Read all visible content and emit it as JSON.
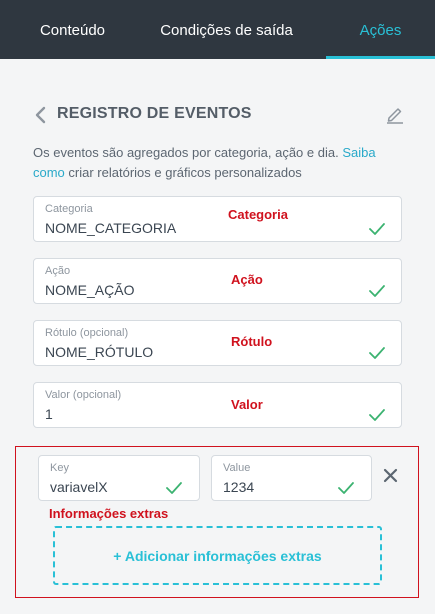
{
  "tabs": [
    {
      "label": "Conteúdo",
      "active": false
    },
    {
      "label": "Condições de saída",
      "active": false
    },
    {
      "label": "Ações",
      "active": true
    }
  ],
  "header": {
    "title": "REGISTRO DE EVENTOS",
    "back_icon": "chevron-left-icon",
    "edit_icon": "pencil-icon"
  },
  "description": {
    "text_before": "Os eventos são agregados por categoria, ação e dia. ",
    "link": "Saiba como",
    "text_after": " criar relatórios e gráficos personalizados"
  },
  "fields": [
    {
      "label": "Categoria",
      "value": "NOME_CATEGORIA",
      "annotation": "Categoria",
      "valid": true
    },
    {
      "label": "Ação",
      "value": "NOME_AÇÃO",
      "annotation": "Ação",
      "valid": true
    },
    {
      "label": "Rótulo (opcional)",
      "value": "NOME_RÓTULO",
      "annotation": "Rótulo",
      "valid": true
    },
    {
      "label": "Valor (opcional)",
      "value": "1",
      "annotation": "Valor",
      "valid": true
    }
  ],
  "extras": {
    "key_label": "Key",
    "key_value": "variavelX",
    "value_label": "Value",
    "value_value": "1234",
    "annotation": "Informações extras",
    "add_button": "+ Adicionar informações extras",
    "remove_icon": "close-icon"
  },
  "colors": {
    "accent": "#29c0d6",
    "annotation": "#d0121e",
    "valid_check": "#3cb371",
    "tab_bar": "#2f3740"
  }
}
